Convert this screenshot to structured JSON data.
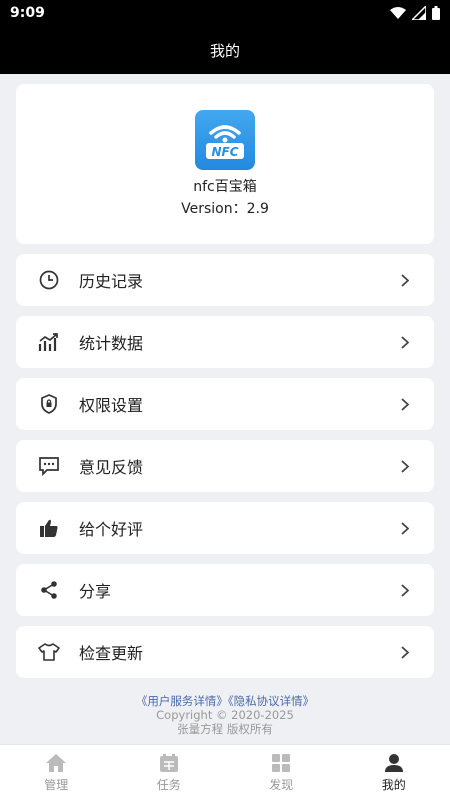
{
  "status_bar": {
    "time": "9:09"
  },
  "header": {
    "title": "我的"
  },
  "app_info": {
    "logo_text": "NFC",
    "name": "nfc百宝箱",
    "version": "Version：2.9"
  },
  "menu": [
    {
      "icon": "clock-icon",
      "label": "历史记录"
    },
    {
      "icon": "chart-icon",
      "label": "统计数据"
    },
    {
      "icon": "shield-icon",
      "label": "权限设置"
    },
    {
      "icon": "message-icon",
      "label": "意见反馈"
    },
    {
      "icon": "thumbs-up-icon",
      "label": "给个好评"
    },
    {
      "icon": "share-icon",
      "label": "分享"
    },
    {
      "icon": "shirt-icon",
      "label": "检查更新"
    }
  ],
  "footer": {
    "links": "《用户服务详情》《隐私协议详情》",
    "copyright": "Copyright © 2020-2025",
    "owner": "张量方程  版权所有"
  },
  "tabs": [
    {
      "icon": "home-icon",
      "label": "管理",
      "active": false
    },
    {
      "icon": "task-icon",
      "label": "任务",
      "active": false
    },
    {
      "icon": "discover-icon",
      "label": "发现",
      "active": false
    },
    {
      "icon": "profile-icon",
      "label": "我的",
      "active": true
    }
  ]
}
